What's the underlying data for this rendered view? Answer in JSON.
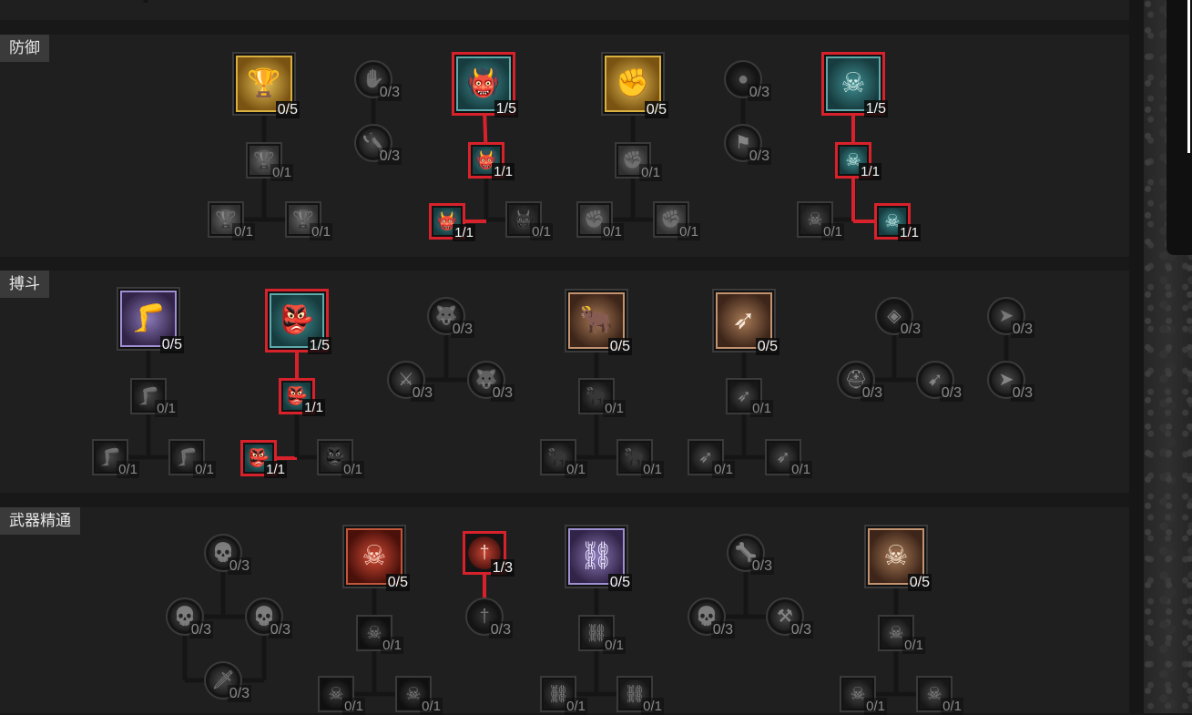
{
  "sections": {
    "defense": {
      "label": "防御"
    },
    "brawling": {
      "label": "搏斗"
    },
    "weapon_mastery": {
      "label": "武器精通"
    }
  },
  "colors": {
    "selected_border": "#d8222b",
    "panel": "#1f1f1f",
    "connector_active": "#d8222b",
    "connector_inactive": "#151515"
  },
  "nodes": [
    {
      "section": "defense",
      "icon": "goblet-icon",
      "rank": "0/5"
    },
    {
      "section": "defense",
      "icon": "goblet-icon",
      "rank": "0/1"
    },
    {
      "section": "defense",
      "icon": "goblet-icon",
      "rank": "0/1"
    },
    {
      "section": "defense",
      "icon": "goblet-icon",
      "rank": "0/1"
    },
    {
      "section": "defense",
      "icon": "claw-icon",
      "rank": "0/3"
    },
    {
      "section": "defense",
      "icon": "axe-icon",
      "rank": "0/3"
    },
    {
      "section": "defense",
      "icon": "demon-face-icon",
      "rank": "1/5"
    },
    {
      "section": "defense",
      "icon": "demon-face-icon",
      "rank": "1/1"
    },
    {
      "section": "defense",
      "icon": "demon-face-icon",
      "rank": "1/1"
    },
    {
      "section": "defense",
      "icon": "demon-face-icon",
      "rank": "0/1"
    },
    {
      "section": "defense",
      "icon": "fist-shield-icon",
      "rank": "0/5"
    },
    {
      "section": "defense",
      "icon": "fist-shield-icon",
      "rank": "0/1"
    },
    {
      "section": "defense",
      "icon": "fist-shield-icon",
      "rank": "0/1"
    },
    {
      "section": "defense",
      "icon": "fist-shield-icon",
      "rank": "0/1"
    },
    {
      "section": "defense",
      "icon": "blood-orb-icon",
      "rank": "0/3"
    },
    {
      "section": "defense",
      "icon": "banner-icon",
      "rank": "0/3"
    },
    {
      "section": "defense",
      "icon": "skulls-icon",
      "rank": "1/5"
    },
    {
      "section": "defense",
      "icon": "skulls-icon",
      "rank": "1/1"
    },
    {
      "section": "defense",
      "icon": "skulls-icon",
      "rank": "0/1"
    },
    {
      "section": "defense",
      "icon": "skulls-icon",
      "rank": "1/1"
    },
    {
      "section": "brawling",
      "icon": "kick-icon",
      "rank": "0/5"
    },
    {
      "section": "brawling",
      "icon": "kick-icon",
      "rank": "0/1"
    },
    {
      "section": "brawling",
      "icon": "kick-icon",
      "rank": "0/1"
    },
    {
      "section": "brawling",
      "icon": "kick-icon",
      "rank": "0/1"
    },
    {
      "section": "brawling",
      "icon": "horned-warrior-icon",
      "rank": "1/5"
    },
    {
      "section": "brawling",
      "icon": "horned-warrior-icon",
      "rank": "1/1"
    },
    {
      "section": "brawling",
      "icon": "horned-warrior-icon",
      "rank": "1/1"
    },
    {
      "section": "brawling",
      "icon": "horned-warrior-icon",
      "rank": "0/1"
    },
    {
      "section": "brawling",
      "icon": "wolf-icon",
      "rank": "0/3"
    },
    {
      "section": "brawling",
      "icon": "warrior-icon",
      "rank": "0/3"
    },
    {
      "section": "brawling",
      "icon": "wolf-icon",
      "rank": "0/3"
    },
    {
      "section": "brawling",
      "icon": "bull-charge-icon",
      "rank": "0/5"
    },
    {
      "section": "brawling",
      "icon": "bull-charge-icon",
      "rank": "0/1"
    },
    {
      "section": "brawling",
      "icon": "bull-charge-icon",
      "rank": "0/1"
    },
    {
      "section": "brawling",
      "icon": "bull-charge-icon",
      "rank": "0/1"
    },
    {
      "section": "brawling",
      "icon": "leap-icon",
      "rank": "0/5"
    },
    {
      "section": "brawling",
      "icon": "leap-icon",
      "rank": "0/1"
    },
    {
      "section": "brawling",
      "icon": "leap-icon",
      "rank": "0/1"
    },
    {
      "section": "brawling",
      "icon": "leap-icon",
      "rank": "0/1"
    },
    {
      "section": "brawling",
      "icon": "demon-mask-icon",
      "rank": "0/3"
    },
    {
      "section": "brawling",
      "icon": "helm-icon",
      "rank": "0/3"
    },
    {
      "section": "brawling",
      "icon": "skull-arrow-icon",
      "rank": "0/3"
    },
    {
      "section": "brawling",
      "icon": "charge-icon",
      "rank": "0/3"
    },
    {
      "section": "brawling",
      "icon": "charge-icon",
      "rank": "0/3"
    },
    {
      "section": "weapon_mastery",
      "icon": "skull-icon",
      "rank": "0/3"
    },
    {
      "section": "weapon_mastery",
      "icon": "skull-icon",
      "rank": "0/3"
    },
    {
      "section": "weapon_mastery",
      "icon": "skull-icon",
      "rank": "0/3"
    },
    {
      "section": "weapon_mastery",
      "icon": "sword-icon",
      "rank": "0/3"
    },
    {
      "section": "weapon_mastery",
      "icon": "sword-skull-icon",
      "rank": "0/5"
    },
    {
      "section": "weapon_mastery",
      "icon": "sword-skull-icon",
      "rank": "0/1"
    },
    {
      "section": "weapon_mastery",
      "icon": "sword-skull-icon",
      "rank": "0/1"
    },
    {
      "section": "weapon_mastery",
      "icon": "sword-skull-icon",
      "rank": "0/1"
    },
    {
      "section": "weapon_mastery",
      "icon": "blade-icon",
      "rank": "1/3"
    },
    {
      "section": "weapon_mastery",
      "icon": "blade-icon",
      "rank": "0/3"
    },
    {
      "section": "weapon_mastery",
      "icon": "chain-icon",
      "rank": "0/5"
    },
    {
      "section": "weapon_mastery",
      "icon": "chain-icon",
      "rank": "0/1"
    },
    {
      "section": "weapon_mastery",
      "icon": "chain-icon",
      "rank": "0/1"
    },
    {
      "section": "weapon_mastery",
      "icon": "chain-icon",
      "rank": "0/1"
    },
    {
      "section": "weapon_mastery",
      "icon": "bone-icon",
      "rank": "0/3"
    },
    {
      "section": "weapon_mastery",
      "icon": "skull-icon",
      "rank": "0/3"
    },
    {
      "section": "weapon_mastery",
      "icon": "mace-icon",
      "rank": "0/3"
    },
    {
      "section": "weapon_mastery",
      "icon": "spiked-skull-icon",
      "rank": "0/5"
    },
    {
      "section": "weapon_mastery",
      "icon": "spiked-skull-icon",
      "rank": "0/1"
    },
    {
      "section": "weapon_mastery",
      "icon": "spiked-skull-icon",
      "rank": "0/1"
    },
    {
      "section": "weapon_mastery",
      "icon": "spiked-skull-icon",
      "rank": "0/1"
    }
  ]
}
